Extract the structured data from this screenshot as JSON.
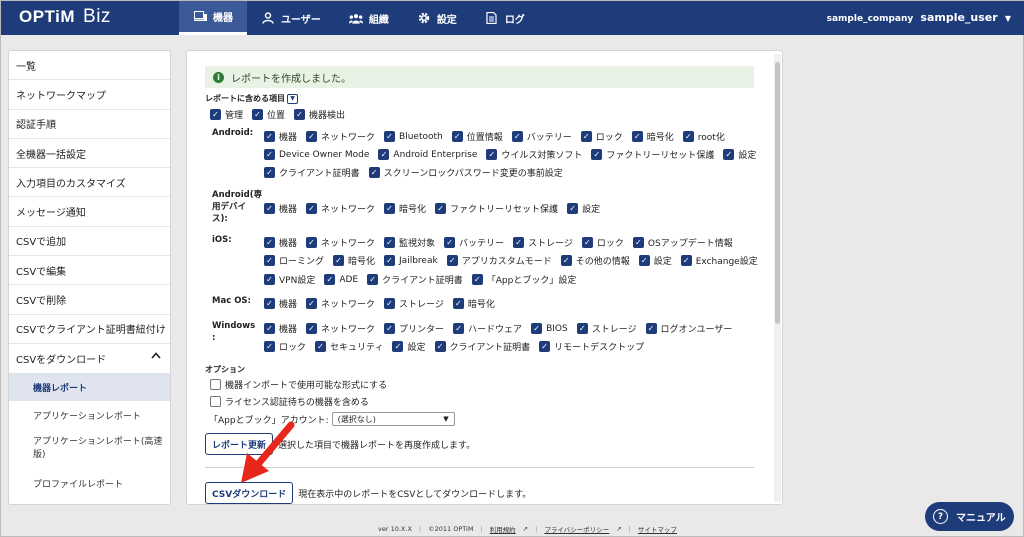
{
  "header": {
    "logo_main": "OPTiM",
    "logo_sub": "Biz",
    "nav": [
      {
        "label": "機器",
        "icon": "device-icon"
      },
      {
        "label": "ユーザー",
        "icon": "user-icon"
      },
      {
        "label": "組織",
        "icon": "organization-icon"
      },
      {
        "label": "設定",
        "icon": "gear-icon"
      },
      {
        "label": "ログ",
        "icon": "log-icon"
      }
    ],
    "company": "sample_company",
    "user": "sample_user"
  },
  "sidebar": {
    "items": [
      "一覧",
      "ネットワークマップ",
      "認証手順",
      "全機器一括設定",
      "入力項目のカスタマイズ",
      "メッセージ通知",
      "CSVで追加",
      "CSVで編集",
      "CSVで削除",
      "CSVでクライアント証明書紐付け",
      "CSVをダウンロード"
    ],
    "subitems": [
      "機器レポート",
      "アプリケーションレポート",
      "アプリケーションレポート(高速版)",
      "プロファイルレポート"
    ]
  },
  "main": {
    "alert": "レポートを作成しました。",
    "report_items_heading": "レポートに含める項目",
    "top_checks": [
      "管理",
      "位置",
      "機器検出"
    ],
    "android": {
      "label": "Android:",
      "row1": [
        "機器",
        "ネットワーク",
        "Bluetooth",
        "位置情報",
        "バッテリー",
        "ロック",
        "暗号化",
        "root化"
      ],
      "row2": [
        "Device Owner Mode",
        "Android Enterprise",
        "ウイルス対策ソフト",
        "ファクトリーリセット保護",
        "設定"
      ],
      "row3": [
        "クライアント証明書",
        "スクリーンロックパスワード変更の事前設定"
      ]
    },
    "android_dedicated": {
      "label": "Android(専用デバイス):",
      "row1": [
        "機器",
        "ネットワーク",
        "暗号化",
        "ファクトリーリセット保護",
        "設定"
      ]
    },
    "ios": {
      "label": "iOS:",
      "row1": [
        "機器",
        "ネットワーク",
        "監視対象",
        "バッテリー",
        "ストレージ",
        "ロック",
        "OSアップデート情報"
      ],
      "row2": [
        "ローミング",
        "暗号化",
        "Jailbreak",
        "アプリカスタムモード",
        "その他の情報",
        "設定",
        "Exchange設定"
      ],
      "row3": [
        "VPN設定",
        "ADE",
        "クライアント証明書",
        "「Appとブック」設定"
      ]
    },
    "macos": {
      "label": "Mac OS:",
      "row1": [
        "機器",
        "ネットワーク",
        "ストレージ",
        "暗号化"
      ]
    },
    "windows": {
      "label": "Windows :",
      "row1": [
        "機器",
        "ネットワーク",
        "プリンター",
        "ハードウェア",
        "BIOS",
        "ストレージ",
        "ログオンユーザー"
      ],
      "row2": [
        "ロック",
        "セキュリティ",
        "設定",
        "クライアント証明書",
        "リモートデスクトップ"
      ]
    },
    "options_heading": "オプション",
    "option1": "機器インポートで使用可能な形式にする",
    "option2": "ライセンス認証待ちの機器を含める",
    "account_label": "「Appとブック」アカウント:",
    "account_value": "(選択なし)",
    "update_button": "レポート更新",
    "update_note": "選択した項目で機器レポートを再度作成します。",
    "csv_button": "CSVダウンロード",
    "csv_note": "現在表示中のレポートをCSVとしてダウンロードします。"
  },
  "footer": {
    "version": "ver 10.X.X",
    "copyright": "©2011 OPTiM",
    "terms": "利用規約",
    "privacy": "プライバシーポリシー",
    "sitemap": "サイトマップ"
  },
  "manual_button": "マニュアル",
  "colors": {
    "brand": "#1f3c7a",
    "alert_bg": "#e9f3e5",
    "arrow": "#e8271c"
  }
}
